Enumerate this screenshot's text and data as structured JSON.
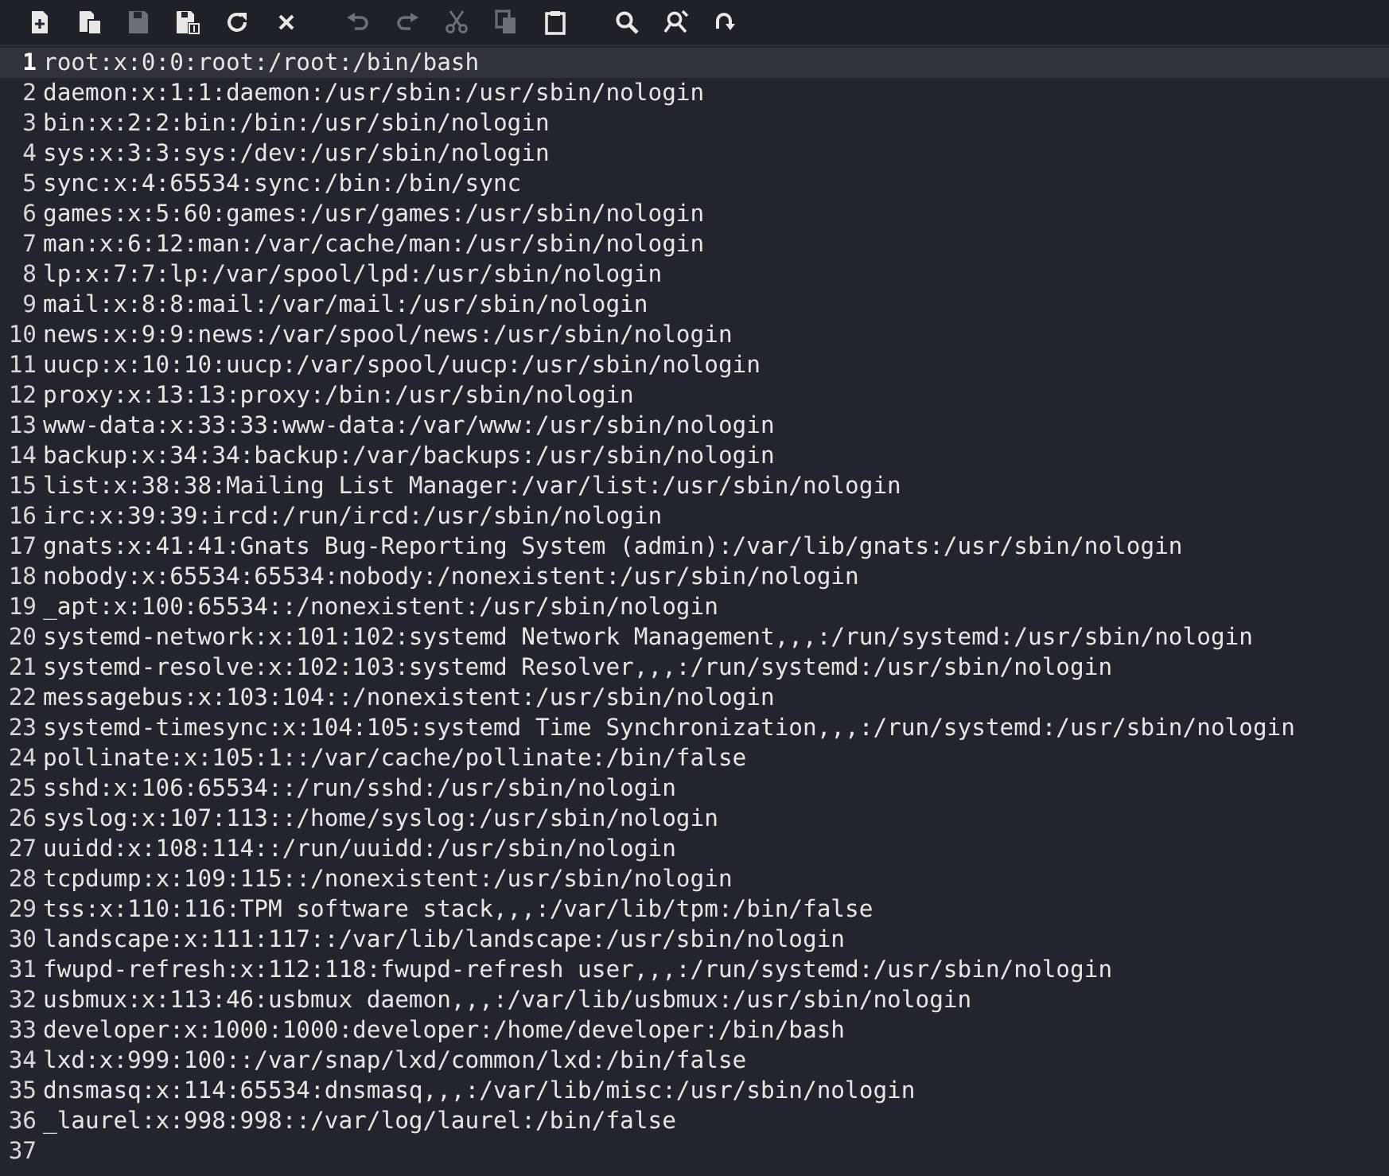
{
  "toolbar": {
    "groups": [
      [
        {
          "kind": "new",
          "disabled": false
        },
        {
          "kind": "copyfile",
          "disabled": false
        },
        {
          "kind": "save",
          "disabled": true
        },
        {
          "kind": "saveas",
          "disabled": false
        },
        {
          "kind": "reload",
          "disabled": false
        },
        {
          "kind": "close",
          "disabled": false
        }
      ],
      [
        {
          "kind": "undo",
          "disabled": true
        },
        {
          "kind": "redo",
          "disabled": true
        },
        {
          "kind": "cut",
          "disabled": true
        },
        {
          "kind": "copy",
          "disabled": true
        },
        {
          "kind": "paste",
          "disabled": false
        }
      ],
      [
        {
          "kind": "search",
          "disabled": false
        },
        {
          "kind": "replace",
          "disabled": false
        },
        {
          "kind": "goto",
          "disabled": false
        }
      ]
    ]
  },
  "lines": [
    {
      "number": "1",
      "text": "root:x:0:0:root:/root:/bin/bash",
      "selected": true
    },
    {
      "number": "2",
      "text": "daemon:x:1:1:daemon:/usr/sbin:/usr/sbin/nologin",
      "selected": false
    },
    {
      "number": "3",
      "text": "bin:x:2:2:bin:/bin:/usr/sbin/nologin",
      "selected": false
    },
    {
      "number": "4",
      "text": "sys:x:3:3:sys:/dev:/usr/sbin/nologin",
      "selected": false
    },
    {
      "number": "5",
      "text": "sync:x:4:65534:sync:/bin:/bin/sync",
      "selected": false
    },
    {
      "number": "6",
      "text": "games:x:5:60:games:/usr/games:/usr/sbin/nologin",
      "selected": false
    },
    {
      "number": "7",
      "text": "man:x:6:12:man:/var/cache/man:/usr/sbin/nologin",
      "selected": false
    },
    {
      "number": "8",
      "text": "lp:x:7:7:lp:/var/spool/lpd:/usr/sbin/nologin",
      "selected": false
    },
    {
      "number": "9",
      "text": "mail:x:8:8:mail:/var/mail:/usr/sbin/nologin",
      "selected": false
    },
    {
      "number": "10",
      "text": "news:x:9:9:news:/var/spool/news:/usr/sbin/nologin",
      "selected": false
    },
    {
      "number": "11",
      "text": "uucp:x:10:10:uucp:/var/spool/uucp:/usr/sbin/nologin",
      "selected": false
    },
    {
      "number": "12",
      "text": "proxy:x:13:13:proxy:/bin:/usr/sbin/nologin",
      "selected": false
    },
    {
      "number": "13",
      "text": "www-data:x:33:33:www-data:/var/www:/usr/sbin/nologin",
      "selected": false
    },
    {
      "number": "14",
      "text": "backup:x:34:34:backup:/var/backups:/usr/sbin/nologin",
      "selected": false
    },
    {
      "number": "15",
      "text": "list:x:38:38:Mailing List Manager:/var/list:/usr/sbin/nologin",
      "selected": false
    },
    {
      "number": "16",
      "text": "irc:x:39:39:ircd:/run/ircd:/usr/sbin/nologin",
      "selected": false
    },
    {
      "number": "17",
      "text": "gnats:x:41:41:Gnats Bug-Reporting System (admin):/var/lib/gnats:/usr/sbin/nologin",
      "selected": false
    },
    {
      "number": "18",
      "text": "nobody:x:65534:65534:nobody:/nonexistent:/usr/sbin/nologin",
      "selected": false
    },
    {
      "number": "19",
      "text": "_apt:x:100:65534::/nonexistent:/usr/sbin/nologin",
      "selected": false
    },
    {
      "number": "20",
      "text": "systemd-network:x:101:102:systemd Network Management,,,:/run/systemd:/usr/sbin/nologin",
      "selected": false
    },
    {
      "number": "21",
      "text": "systemd-resolve:x:102:103:systemd Resolver,,,:/run/systemd:/usr/sbin/nologin",
      "selected": false
    },
    {
      "number": "22",
      "text": "messagebus:x:103:104::/nonexistent:/usr/sbin/nologin",
      "selected": false
    },
    {
      "number": "23",
      "text": "systemd-timesync:x:104:105:systemd Time Synchronization,,,:/run/systemd:/usr/sbin/nologin",
      "selected": false
    },
    {
      "number": "24",
      "text": "pollinate:x:105:1::/var/cache/pollinate:/bin/false",
      "selected": false
    },
    {
      "number": "25",
      "text": "sshd:x:106:65534::/run/sshd:/usr/sbin/nologin",
      "selected": false
    },
    {
      "number": "26",
      "text": "syslog:x:107:113::/home/syslog:/usr/sbin/nologin",
      "selected": false
    },
    {
      "number": "27",
      "text": "uuidd:x:108:114::/run/uuidd:/usr/sbin/nologin",
      "selected": false
    },
    {
      "number": "28",
      "text": "tcpdump:x:109:115::/nonexistent:/usr/sbin/nologin",
      "selected": false
    },
    {
      "number": "29",
      "text": "tss:x:110:116:TPM software stack,,,:/var/lib/tpm:/bin/false",
      "selected": false
    },
    {
      "number": "30",
      "text": "landscape:x:111:117::/var/lib/landscape:/usr/sbin/nologin",
      "selected": false
    },
    {
      "number": "31",
      "text": "fwupd-refresh:x:112:118:fwupd-refresh user,,,:/run/systemd:/usr/sbin/nologin",
      "selected": false
    },
    {
      "number": "32",
      "text": "usbmux:x:113:46:usbmux daemon,,,:/var/lib/usbmux:/usr/sbin/nologin",
      "selected": false
    },
    {
      "number": "33",
      "text": "developer:x:1000:1000:developer:/home/developer:/bin/bash",
      "selected": false
    },
    {
      "number": "34",
      "text": "lxd:x:999:100::/var/snap/lxd/common/lxd:/bin/false",
      "selected": false
    },
    {
      "number": "35",
      "text": "dnsmasq:x:114:65534:dnsmasq,,,:/var/lib/misc:/usr/sbin/nologin",
      "selected": false
    },
    {
      "number": "36",
      "text": "_laurel:x:998:998::/var/log/laurel:/bin/false",
      "selected": false
    },
    {
      "number": "37",
      "selected": false
    }
  ]
}
